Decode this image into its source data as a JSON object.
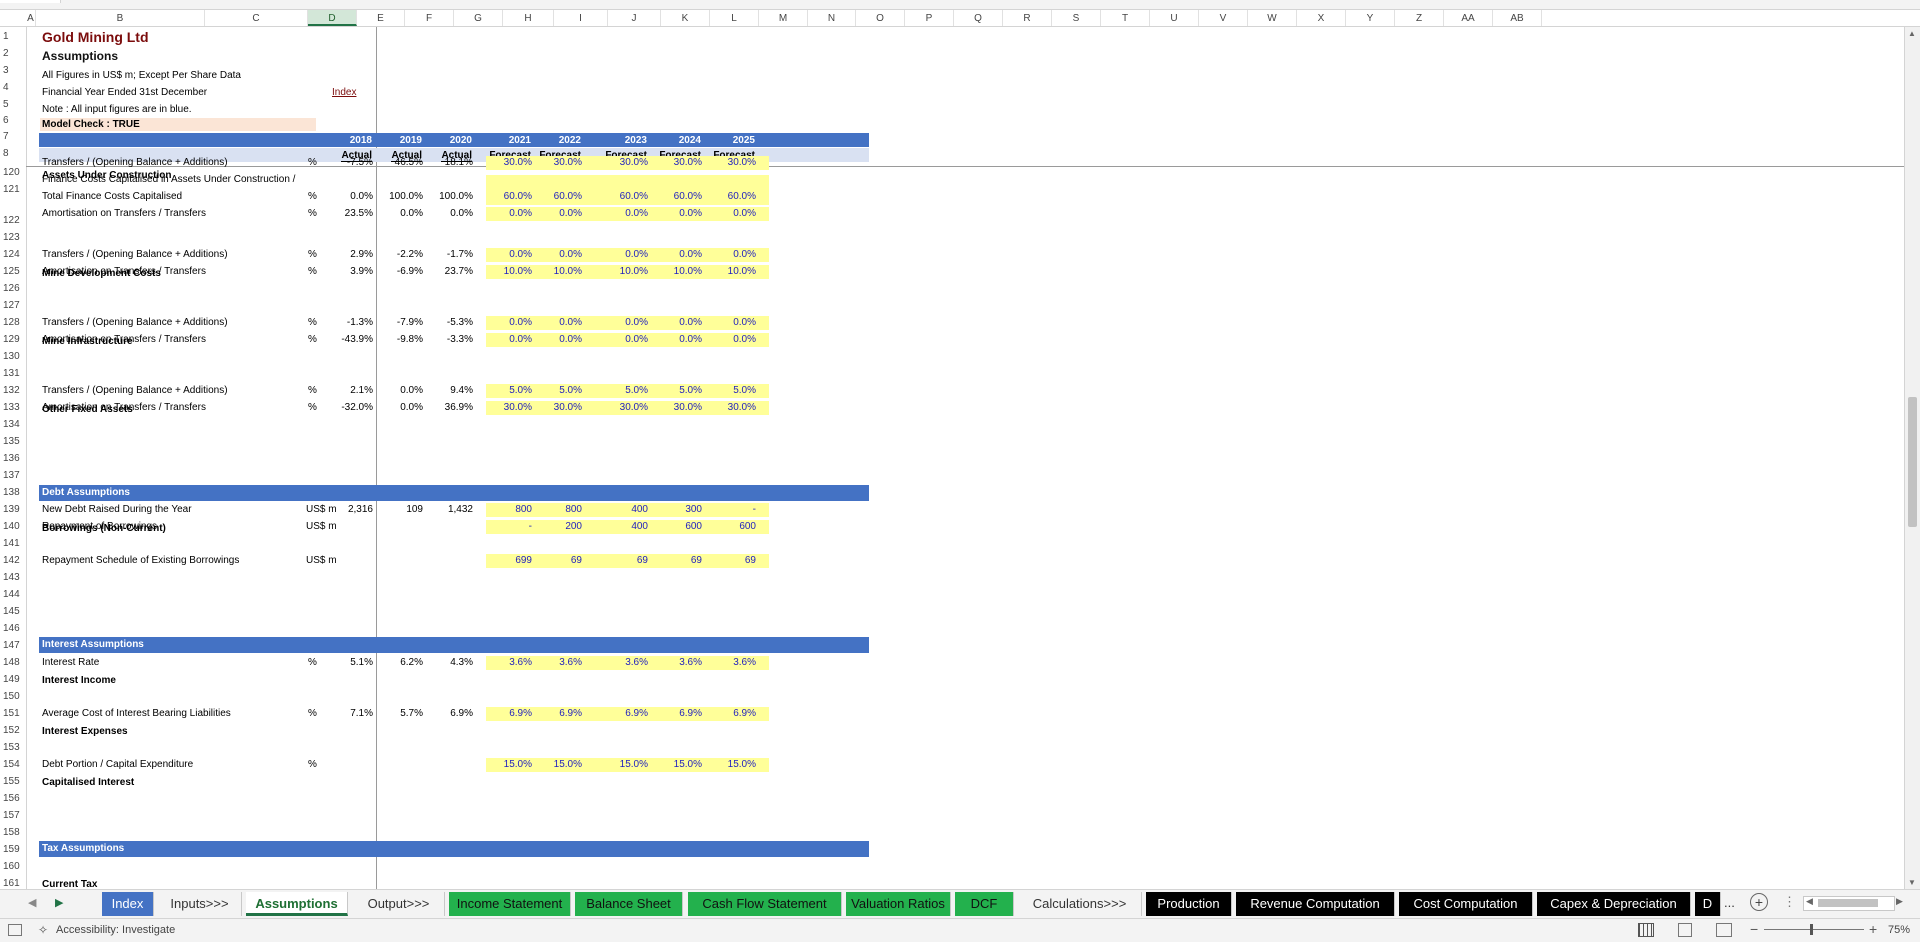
{
  "columns": [
    "A",
    "B",
    "C",
    "D",
    "E",
    "F",
    "G",
    "H",
    "I",
    "J",
    "K",
    "L",
    "M",
    "N",
    "O",
    "P",
    "Q",
    "R",
    "S",
    "T",
    "U",
    "V",
    "W",
    "X",
    "Y",
    "Z",
    "AA",
    "AB"
  ],
  "selected_column": "D",
  "rows": [
    "1",
    "2",
    "3",
    "4",
    "5",
    "6",
    "7",
    "8",
    "120",
    "121",
    "",
    "122",
    "123",
    "124",
    "125",
    "126",
    "127",
    "128",
    "129",
    "130",
    "131",
    "132",
    "133",
    "134",
    "135",
    "136",
    "137",
    "138",
    "139",
    "140",
    "141",
    "142",
    "143",
    "144",
    "145",
    "146",
    "147",
    "148",
    "149",
    "150",
    "151",
    "152",
    "153",
    "154",
    "155",
    "156",
    "157",
    "158",
    "159",
    "160",
    "161"
  ],
  "header": {
    "company": "Gold Mining Ltd",
    "sheet_title": "Assumptions",
    "note1": "All Figures in US$ m; Except Per Share Data",
    "note2": "Financial Year Ended 31st December",
    "index_link": "Index",
    "note3": "Note :  All input figures are in blue.",
    "model_check": "Model Check : TRUE"
  },
  "years": [
    "2018",
    "2019",
    "2020",
    "2021",
    "2022",
    "2023",
    "2024",
    "2025"
  ],
  "year_types": [
    "Actual",
    "Actual",
    "Actual",
    "Forecast",
    "Forecast",
    "Forecast",
    "Forecast",
    "Forecast"
  ],
  "sections": {
    "auc": "Assets Under Construction",
    "mdc": "Mine Development Costs",
    "mi": "Mine Infrastructure",
    "ofa": "Other Fixed Assets",
    "debt": "Debt Assumptions",
    "borrow": "Borrowings (Non-Current)",
    "interest": "Interest Assumptions",
    "ii": "Interest Income",
    "ie": "Interest Expenses",
    "ci": "Capitalised Interest",
    "tax": "Tax Assumptions",
    "ct": "Current Tax"
  },
  "lines": [
    {
      "label": "Transfers / (Opening Balance + Additions)",
      "unit": "%",
      "values": [
        "-7.5%",
        "46.5%",
        "18.1%",
        "30.0%",
        "30.0%",
        "30.0%",
        "30.0%",
        "30.0%"
      ]
    },
    {
      "label": "Finance Costs Capitalised in Assets Under Construction /",
      "label2": "Total Finance Costs Capitalised",
      "unit": "%",
      "values": [
        "0.0%",
        "100.0%",
        "100.0%",
        "60.0%",
        "60.0%",
        "60.0%",
        "60.0%",
        "60.0%"
      ]
    },
    {
      "label": "Amortisation on Transfers / Transfers",
      "unit": "%",
      "values": [
        "23.5%",
        "0.0%",
        "0.0%",
        "0.0%",
        "0.0%",
        "0.0%",
        "0.0%",
        "0.0%"
      ]
    },
    {
      "label": "Transfers / (Opening Balance + Additions)",
      "unit": "%",
      "values": [
        "2.9%",
        "-2.2%",
        "-1.7%",
        "0.0%",
        "0.0%",
        "0.0%",
        "0.0%",
        "0.0%"
      ]
    },
    {
      "label": "Amortisation on Transfers / Transfers",
      "unit": "%",
      "values": [
        "3.9%",
        "-6.9%",
        "23.7%",
        "10.0%",
        "10.0%",
        "10.0%",
        "10.0%",
        "10.0%"
      ]
    },
    {
      "label": "Transfers / (Opening Balance + Additions)",
      "unit": "%",
      "values": [
        "-1.3%",
        "-7.9%",
        "-5.3%",
        "0.0%",
        "0.0%",
        "0.0%",
        "0.0%",
        "0.0%"
      ]
    },
    {
      "label": "Amortisation on Transfers / Transfers",
      "unit": "%",
      "values": [
        "-43.9%",
        "-9.8%",
        "-3.3%",
        "0.0%",
        "0.0%",
        "0.0%",
        "0.0%",
        "0.0%"
      ]
    },
    {
      "label": "Transfers / (Opening Balance + Additions)",
      "unit": "%",
      "values": [
        "2.1%",
        "0.0%",
        "9.4%",
        "5.0%",
        "5.0%",
        "5.0%",
        "5.0%",
        "5.0%"
      ]
    },
    {
      "label": "Amortisation on Transfers / Transfers",
      "unit": "%",
      "values": [
        "-32.0%",
        "0.0%",
        "36.9%",
        "30.0%",
        "30.0%",
        "30.0%",
        "30.0%",
        "30.0%"
      ]
    },
    {
      "label": "New Debt Raised During the Year",
      "unit": "US$ m",
      "values": [
        "2,316",
        "109",
        "1,432",
        "800",
        "800",
        "400",
        "300",
        "-"
      ]
    },
    {
      "label": "Repayment of Borrowings",
      "unit": "US$ m",
      "values": [
        "",
        "",
        "",
        "-",
        "200",
        "400",
        "600",
        "600"
      ]
    },
    {
      "label": "Repayment Schedule of Existing Borrowings",
      "unit": "US$ m",
      "values": [
        "",
        "",
        "",
        "699",
        "69",
        "69",
        "69",
        "69"
      ]
    },
    {
      "label": "Interest Rate",
      "unit": "%",
      "values": [
        "5.1%",
        "6.2%",
        "4.3%",
        "3.6%",
        "3.6%",
        "3.6%",
        "3.6%",
        "3.6%"
      ]
    },
    {
      "label": "Average Cost of Interest Bearing Liabilities",
      "unit": "%",
      "values": [
        "7.1%",
        "5.7%",
        "6.9%",
        "6.9%",
        "6.9%",
        "6.9%",
        "6.9%",
        "6.9%"
      ]
    },
    {
      "label": "Debt Portion / Capital Expenditure",
      "unit": "%",
      "values": [
        "",
        "",
        "",
        "15.0%",
        "15.0%",
        "15.0%",
        "15.0%",
        "15.0%"
      ]
    }
  ],
  "tabs": [
    {
      "label": "Index",
      "style": "b"
    },
    {
      "label": "Inputs>>>",
      "style": "p"
    },
    {
      "label": "Assumptions",
      "style": "act"
    },
    {
      "label": "Output>>>",
      "style": "p"
    },
    {
      "label": "Income Statement",
      "style": "g"
    },
    {
      "label": "Balance Sheet",
      "style": "g"
    },
    {
      "label": "Cash Flow Statement",
      "style": "g"
    },
    {
      "label": "Valuation Ratios",
      "style": "g"
    },
    {
      "label": "DCF",
      "style": "g"
    },
    {
      "label": "Calculations>>>",
      "style": "p"
    },
    {
      "label": "Production",
      "style": "k"
    },
    {
      "label": "Revenue Computation",
      "style": "k"
    },
    {
      "label": "Cost Computation",
      "style": "k"
    },
    {
      "label": "Capex & Depreciation",
      "style": "k"
    },
    {
      "label": "D",
      "style": "k"
    }
  ],
  "tab_more": "...",
  "status": {
    "accessibility": "Accessibility: Investigate",
    "zoom": "75%"
  },
  "colors": {
    "band": "#4472c4",
    "input_fill": "#ffff99",
    "input_text": "#1f1fbf",
    "title": "#7b0c0c",
    "check_fill": "#fbe5d6"
  }
}
